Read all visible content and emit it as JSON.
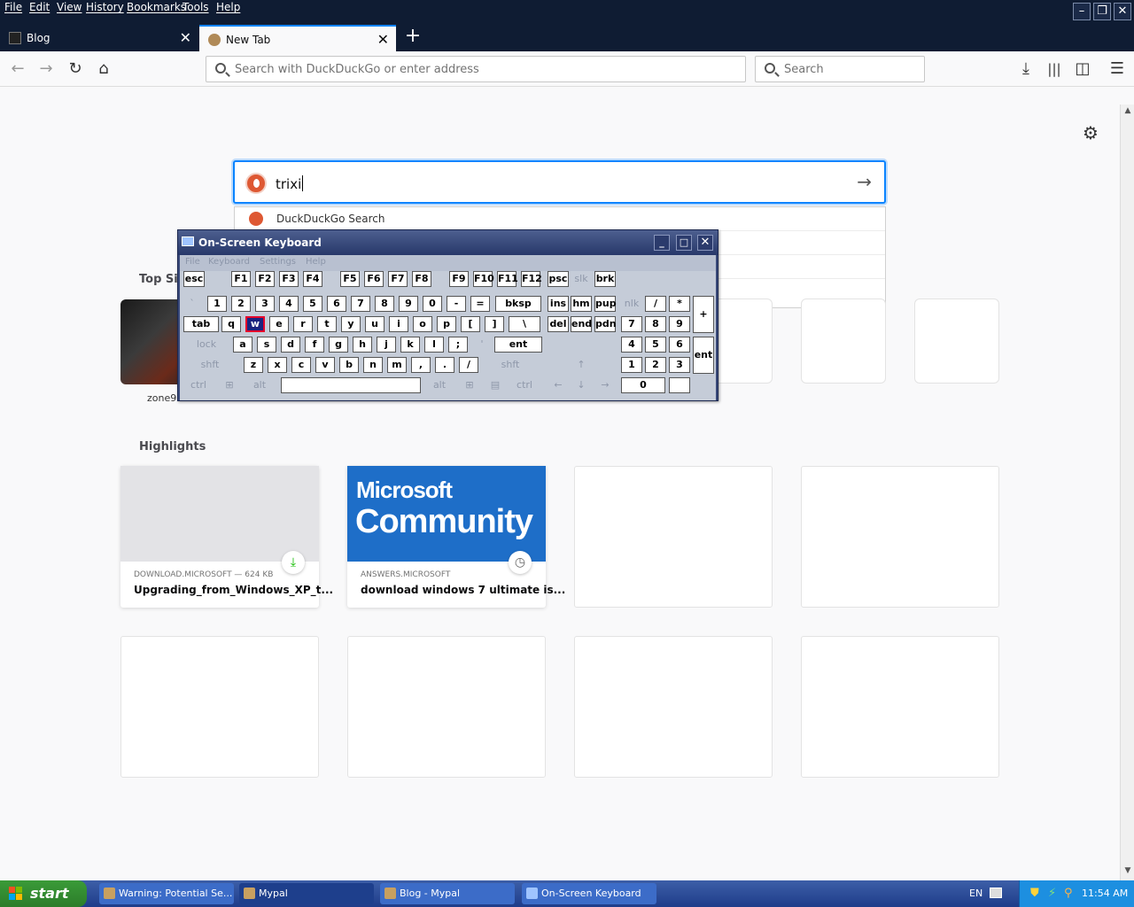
{
  "menubar": {
    "items": [
      "File",
      "Edit",
      "View",
      "History",
      "Bookmarks",
      "Tools",
      "Help"
    ],
    "window_buttons": [
      "minimize",
      "restore",
      "close"
    ]
  },
  "tabs": [
    {
      "title": "Blog",
      "active": false
    },
    {
      "title": "New Tab",
      "active": true
    }
  ],
  "toolbar": {
    "url_placeholder": "Search with DuckDuckGo or enter address",
    "search_placeholder": "Search"
  },
  "newtab": {
    "search_value": "trixi",
    "suggestions": [
      "DuckDuckGo Search"
    ],
    "top_sites_title": "Top Sit",
    "top_sites": [
      {
        "label": "zone9"
      }
    ],
    "highlights_title": "Highlights",
    "highlights": [
      {
        "source": "DOWNLOAD.MICROSOFT — 624 KB",
        "title": "Upgrading_from_Windows_XP_t...",
        "badge": "download-icon"
      },
      {
        "source": "ANSWERS.MICROSOFT",
        "title": "download windows 7 ultimate is...",
        "badge": "clock-icon",
        "image_text": [
          "Microsoft",
          "Community"
        ]
      }
    ]
  },
  "osk": {
    "title": "On-Screen Keyboard",
    "menu": [
      "File",
      "Keyboard",
      "Settings",
      "Help"
    ],
    "pressed_key": "w"
  },
  "taskbar": {
    "start": "start",
    "tasks": [
      "Warning: Potential Se...",
      "Mypal",
      "Blog - Mypal",
      "On-Screen Keyboard"
    ],
    "active_task": "Mypal",
    "lang": "EN",
    "clock": "11:54 AM"
  },
  "colors": {
    "accent": "#0a84ff",
    "titlebar": "#0f1c33",
    "taskbar": "#245edb",
    "start": "#3a9b38"
  }
}
